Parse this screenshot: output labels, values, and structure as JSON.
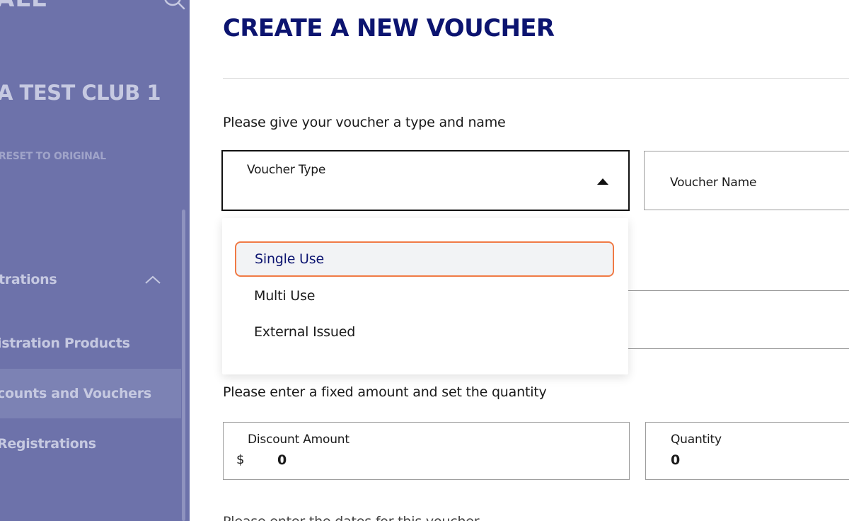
{
  "sidebar": {
    "brand": "ALL",
    "club_name": "A TEST CLUB 1",
    "reset_label": "RESET TO ORIGINAL",
    "section_label": "trations",
    "items": [
      {
        "label": "istration Products"
      },
      {
        "label": "counts and Vouchers"
      },
      {
        "label": "Registrations"
      }
    ]
  },
  "main": {
    "title": "CREATE A NEW VOUCHER",
    "instructions": {
      "type_and_name": "Please give your voucher a type and name",
      "amount_and_quantity": "Please enter a fixed amount and set the quantity",
      "next": "Please enter the dates for this voucher"
    },
    "voucher_type": {
      "label": "Voucher Type",
      "options": [
        "Single Use",
        "Multi Use",
        "External Issued"
      ],
      "highlighted": "Single Use"
    },
    "voucher_name": {
      "label": "Voucher Name"
    },
    "discount": {
      "label": "Discount Amount",
      "currency": "$",
      "value": "0"
    },
    "quantity": {
      "label": "Quantity",
      "value": "0"
    }
  },
  "colors": {
    "sidebar_bg": "#6d72aa",
    "title": "#0c1470",
    "highlight_border": "#f07a45",
    "highlight_bg": "#f2f3f5"
  },
  "icons": [
    "search-icon",
    "chevron-up-icon",
    "caret-up-icon"
  ]
}
